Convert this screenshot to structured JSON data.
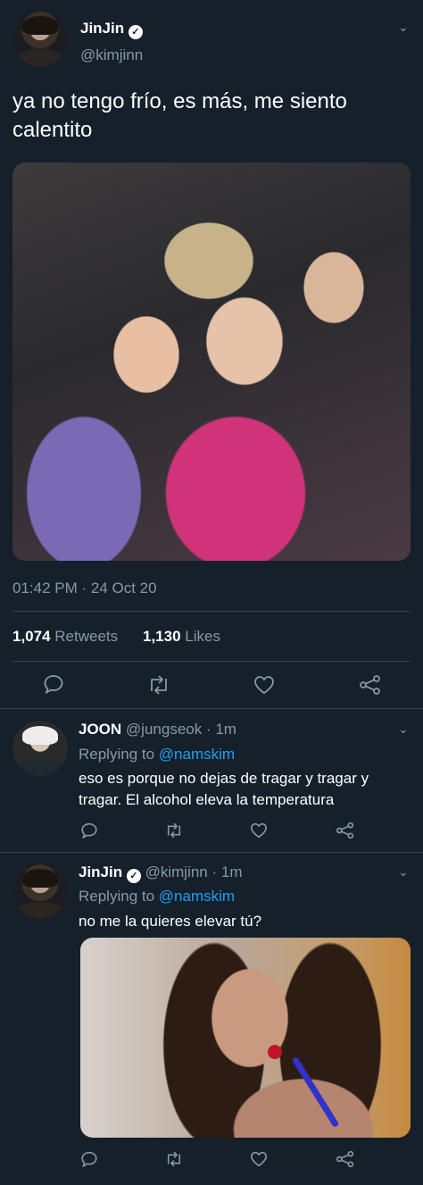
{
  "tweet": {
    "display_name": "JinJin",
    "handle": "@kimjinn",
    "text_line1": "ya no tengo frío, es más, me siento",
    "text_line2": "calentito",
    "timestamp": "01:42 PM · 24 Oct 20",
    "retweets_count": "1,074",
    "retweets_label": "Retweets",
    "likes_count": "1,130",
    "likes_label": "Likes"
  },
  "replies": [
    {
      "display_name": "JOON",
      "handle": "@jungseok",
      "time": "· 1m",
      "replying_to_label": "Replying to",
      "replying_to_handle": "@namskim",
      "text_line1": "eso es porque no dejas de tragar y tragar y",
      "text_line2": "tragar. El alcohol eleva la temperatura"
    },
    {
      "display_name": "JinJin",
      "handle": "@kimjinn",
      "time": "· 1m",
      "replying_to_label": "Replying to",
      "replying_to_handle": "@namskim",
      "text_line1": "no me la quieres elevar tú?"
    }
  ],
  "icons": {
    "reply": "reply-icon",
    "retweet": "retweet-icon",
    "like": "like-icon",
    "share": "share-icon",
    "verified": "verified-badge-icon",
    "chevron": "chevron-down-icon"
  },
  "colors": {
    "background": "#15202b",
    "divider": "#38444d",
    "muted": "#8899a6",
    "link": "#1da1f2"
  }
}
